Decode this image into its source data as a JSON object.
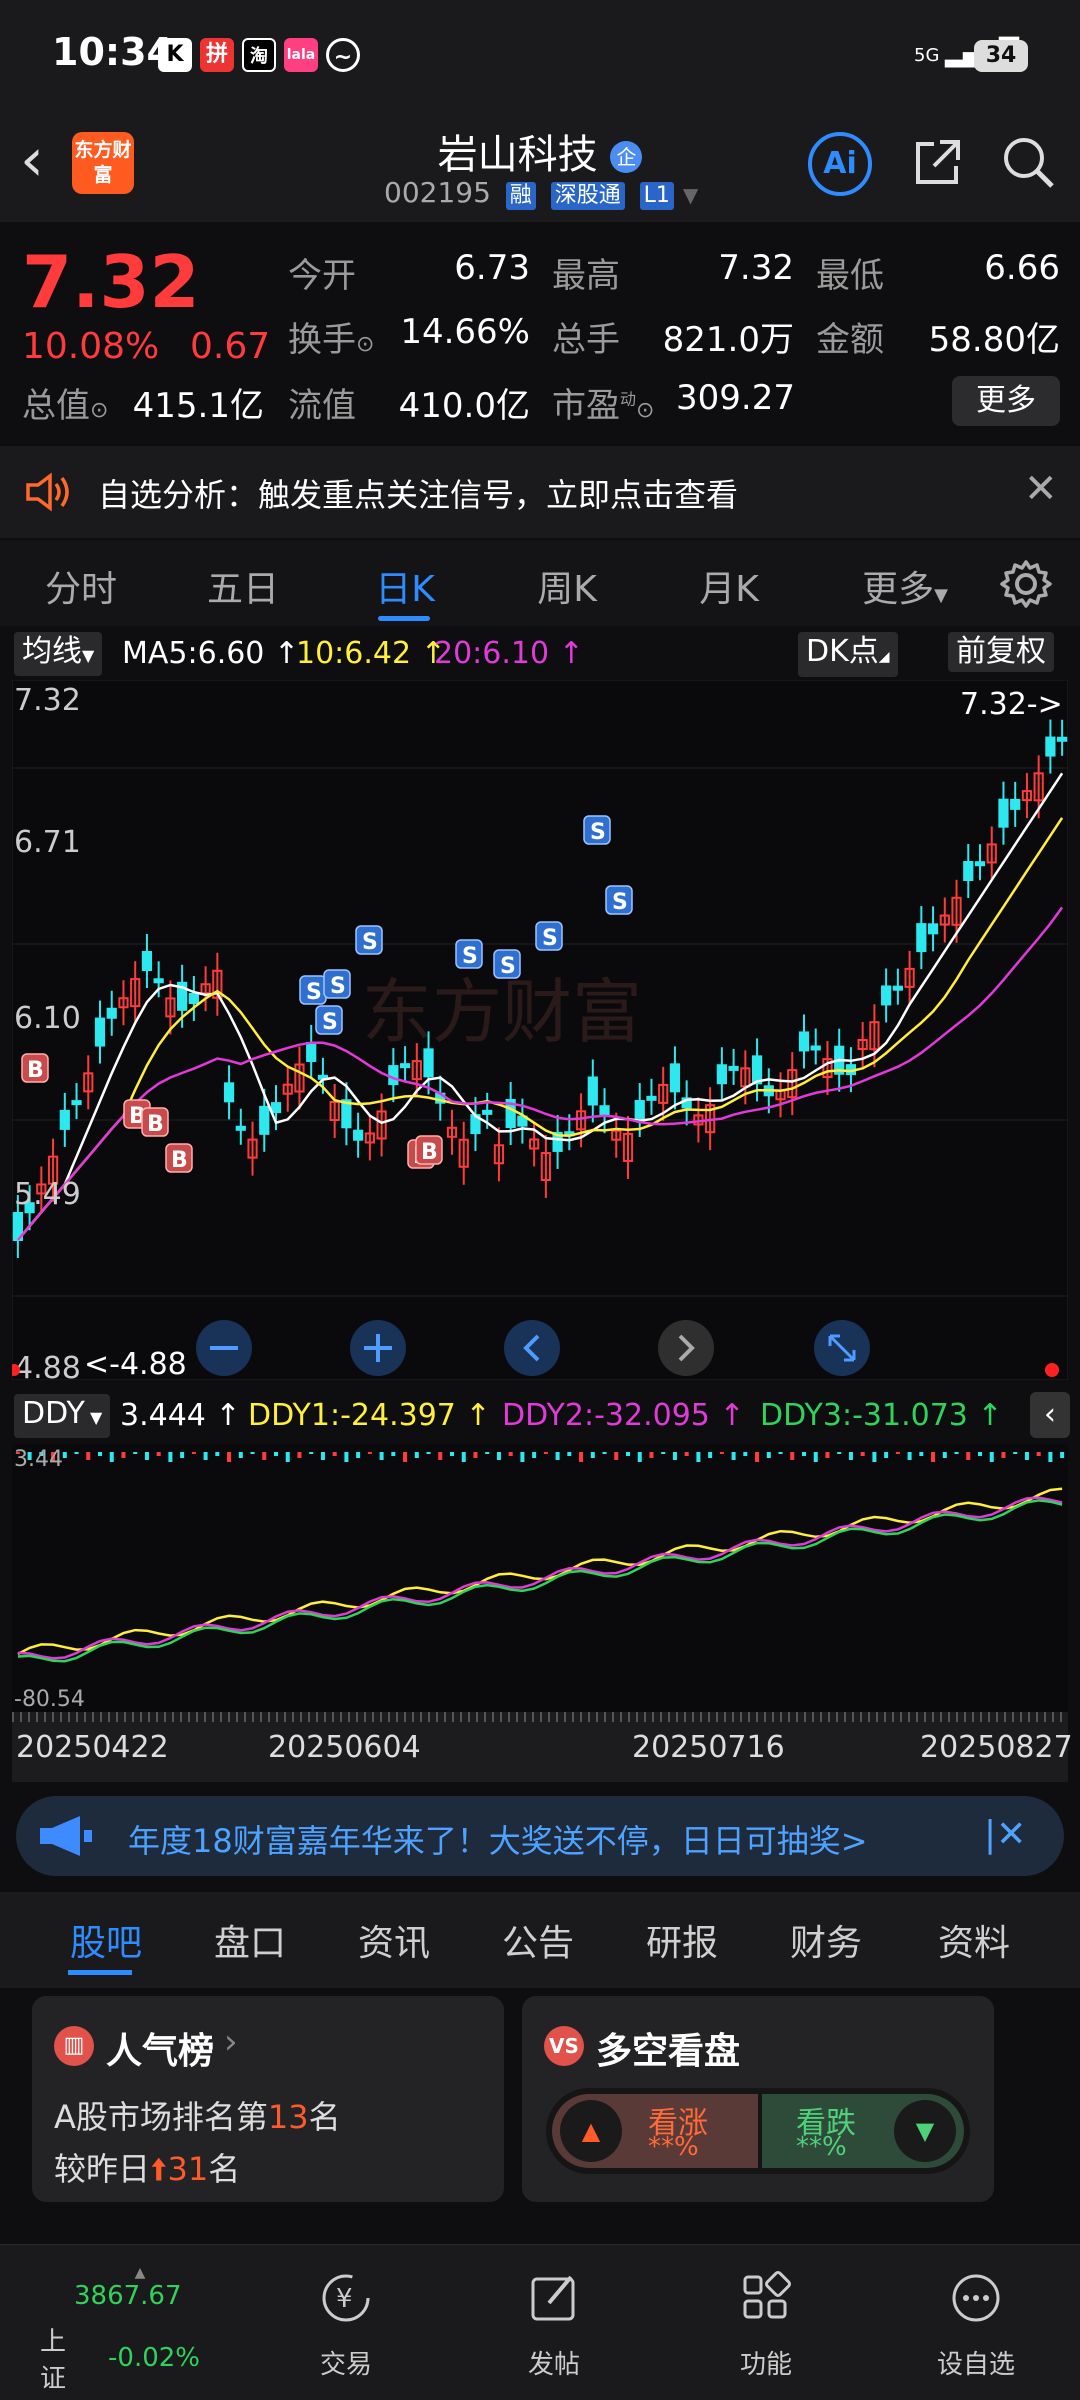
{
  "status_bar": {
    "time": "10:34",
    "app_icons": [
      "K",
      "拼",
      "淘",
      "lala",
      "~"
    ],
    "network": "5G",
    "battery": "34"
  },
  "header": {
    "logo_text": "东方财富",
    "stock_name": "岩山科技",
    "name_badge": "企",
    "stock_code": "002195",
    "tags": [
      "融",
      "深股通",
      "L1"
    ],
    "ai_label": "Ai"
  },
  "quote": {
    "price": "7.32",
    "change_pct": "10.08%",
    "change": "0.67",
    "fields": [
      {
        "label": "今开",
        "value": "6.73",
        "color": "#ff3b3b"
      },
      {
        "label": "最高",
        "value": "7.32",
        "color": "#ff3b3b"
      },
      {
        "label": "最低",
        "value": "6.66",
        "color": "#ff3b3b"
      },
      {
        "label": "换手",
        "value": "14.66%",
        "color": "#ffffff"
      },
      {
        "label": "总手",
        "value": "821.0万",
        "color": "#ffffff"
      },
      {
        "label": "金额",
        "value": "58.80亿",
        "color": "#ffffff"
      },
      {
        "label": "总值",
        "value": "415.1亿",
        "color": "#ffffff"
      },
      {
        "label": "流值",
        "value": "410.0亿",
        "color": "#ffffff"
      },
      {
        "label": "市盈",
        "value": "309.27",
        "color": "#ffffff"
      }
    ],
    "pe_superscript": "动",
    "more_label": "更多"
  },
  "alert": {
    "text": "自选分析：触发重点关注信号，立即点击查看"
  },
  "chart_tabs": {
    "items": [
      "分时",
      "五日",
      "日K",
      "周K",
      "月K",
      "更多"
    ],
    "active_index": 2
  },
  "ma_row": {
    "selector": "均线",
    "ma5": "MA5:6.60 ↑",
    "ma10": "10:6.42 ↑",
    "ma20": "20:6.10 ↑",
    "dk_label": "DK点",
    "adjust_label": "前复权"
  },
  "main_chart": {
    "y_labels": [
      "7.32",
      "6.71",
      "6.10",
      "5.49",
      "4.88"
    ],
    "last_label": "7.32->",
    "low_label": "<-4.88",
    "watermark": "东方财富",
    "signal_S": "S",
    "signal_B": "B"
  },
  "sub_chart": {
    "selector": "DDY",
    "ddy": "3.444 ↑",
    "ddy1": "DDY1:-24.397 ↑",
    "ddy2": "DDY2:-32.095 ↑",
    "ddy3": "DDY3:-31.073 ↑",
    "top_label": "3.44",
    "bottom_label": "-80.54"
  },
  "date_axis": [
    "20250422",
    "20250604",
    "20250716",
    "20250827"
  ],
  "banner": {
    "text": "年度18财富嘉年华来了！大奖送不停，日日可抽奖>"
  },
  "bottom_tabs": {
    "items": [
      "股吧",
      "盘口",
      "资讯",
      "公告",
      "研报",
      "财务",
      "资料"
    ],
    "active_index": 0
  },
  "popularity_card": {
    "title": "人气榜",
    "line1_prefix": "A股市场排名第",
    "rank": "13",
    "line1_suffix": "名",
    "line2_prefix": "较昨日",
    "rank_change": "31",
    "line2_suffix": "名"
  },
  "vote_card": {
    "title": "多空看盘",
    "up_label": "看涨",
    "up_value": "**%",
    "down_label": "看跌",
    "down_value": "**%"
  },
  "nav": {
    "index_name": "上证",
    "index_value": "3867.67",
    "index_change": "-0.02%",
    "items": [
      "交易",
      "发帖",
      "功能",
      "设自选"
    ]
  },
  "colors": {
    "up": "#ff3b3b",
    "down": "#2fd25a",
    "accent": "#2f8cff",
    "ma5": "#ffffff",
    "ma10": "#ffee3a",
    "ma20": "#e03ad8",
    "candle_down": "#2ee8f0"
  }
}
